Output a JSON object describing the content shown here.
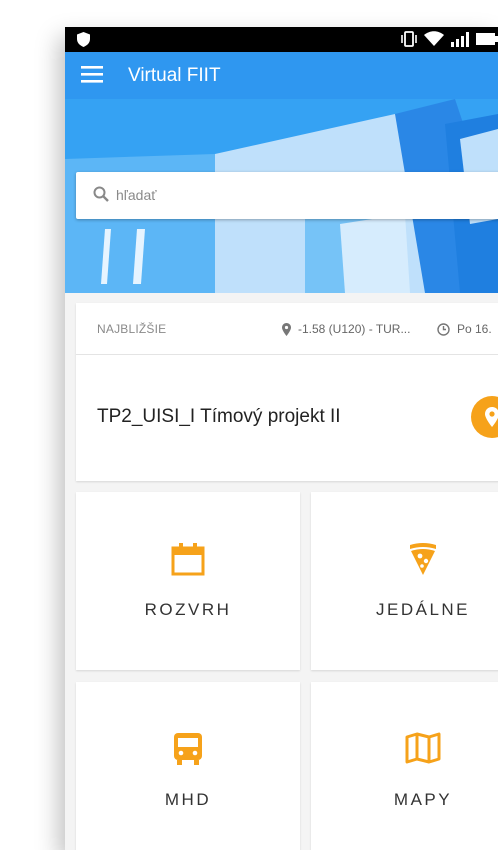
{
  "app": {
    "title": "Virtual FIIT"
  },
  "search": {
    "placeholder": "hľadať"
  },
  "nearest": {
    "label": "NAJBLIŽŠIE",
    "location": "-1.58 (U120) - TUR...",
    "time": "Po 16.",
    "subject": "TP2_UISI_I Tímový projekt II"
  },
  "tiles": [
    {
      "label": "ROZVRH",
      "icon": "calendar-icon"
    },
    {
      "label": "JEDÁLNE",
      "icon": "pizza-icon"
    },
    {
      "label": "MHD",
      "icon": "bus-icon"
    },
    {
      "label": "MAPY",
      "icon": "map-icon"
    }
  ],
  "colors": {
    "primary": "#2f97f0",
    "accent": "#f6a21a"
  }
}
